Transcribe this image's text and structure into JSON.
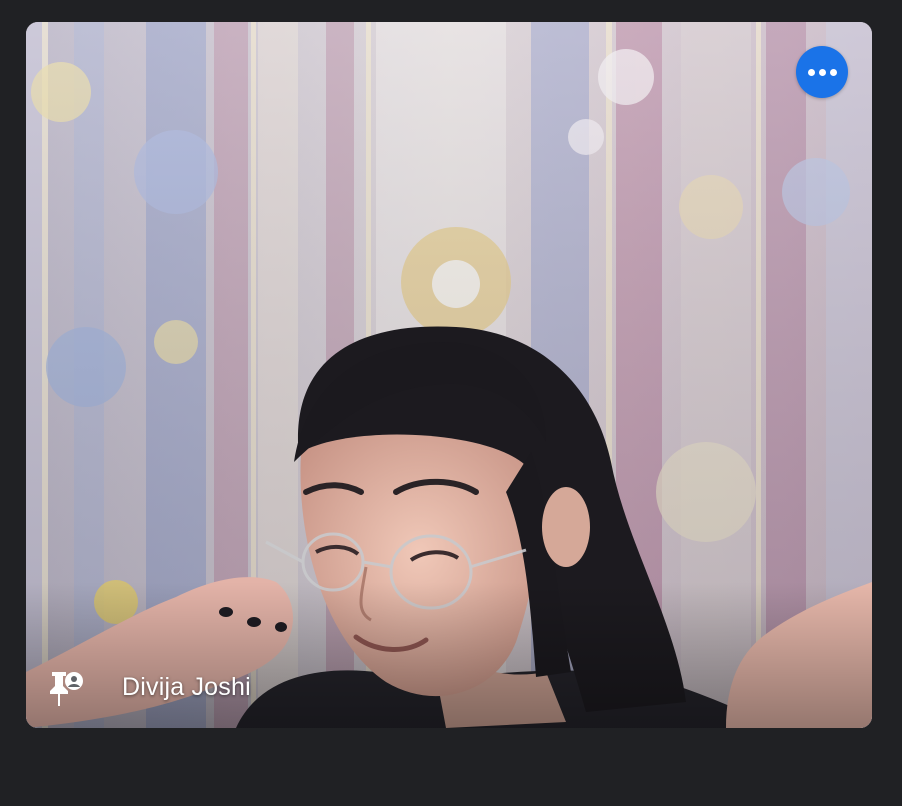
{
  "participant": {
    "name": "Divija Joshi"
  },
  "controls": {
    "more_options_icon": "more-horiz-icon",
    "pin_icon": "pin-icon"
  },
  "colors": {
    "page_background": "#202124",
    "accent": "#1a73e8",
    "name_text": "#ffffff"
  }
}
